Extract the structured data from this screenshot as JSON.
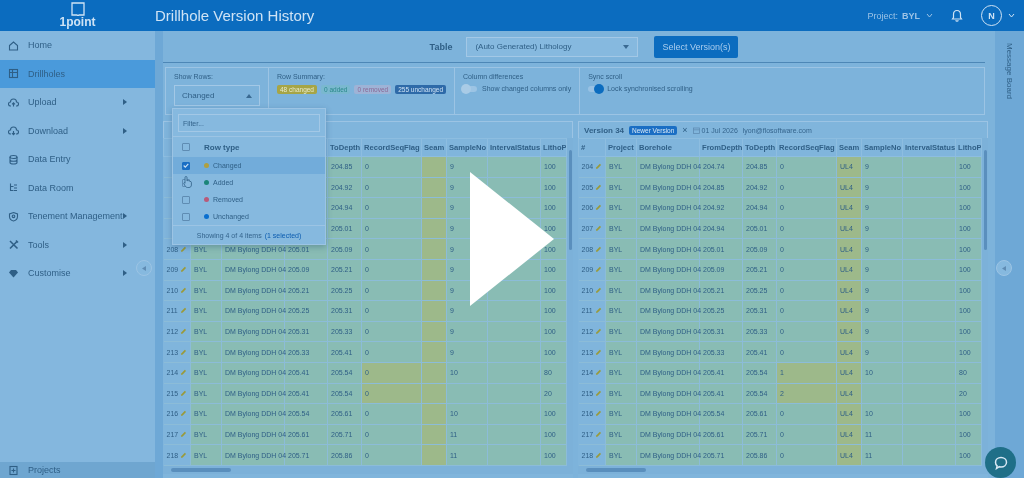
{
  "app": {
    "logo": "1point",
    "title": "Drillhole Version History",
    "project_label": "Project:",
    "project": "BYL",
    "avatar": "N"
  },
  "sidebar": {
    "items": [
      {
        "label": "Home",
        "selected": false,
        "submenu": false
      },
      {
        "label": "Drillholes",
        "selected": true,
        "submenu": false
      },
      {
        "label": "Upload",
        "selected": false,
        "submenu": true
      },
      {
        "label": "Download",
        "selected": false,
        "submenu": true
      },
      {
        "label": "Data Entry",
        "selected": false,
        "submenu": false
      },
      {
        "label": "Data Room",
        "selected": false,
        "submenu": false
      },
      {
        "label": "Tenement Management",
        "selected": false,
        "submenu": true
      },
      {
        "label": "Tools",
        "selected": false,
        "submenu": true
      },
      {
        "label": "Customise",
        "selected": false,
        "submenu": true
      }
    ],
    "footer": "Projects"
  },
  "toolbar": {
    "table_label": "Table",
    "table_value": "(Auto Generated) Lithology",
    "button": "Select Version(s)"
  },
  "filters": {
    "show_rows": {
      "label": "Show Rows:",
      "value": "Changed",
      "expanded": true
    },
    "row_summary": {
      "label": "Row Summary:",
      "badges": [
        {
          "text": "48 changed",
          "kind": "changed"
        },
        {
          "text": "0 added",
          "kind": "added"
        },
        {
          "text": "0 removed",
          "kind": "removed"
        },
        {
          "text": "255 unchanged",
          "kind": "unchanged"
        }
      ]
    },
    "column_differences": {
      "label": "Column differences",
      "toggle": "Show changed columns only",
      "on": false
    },
    "sync_scroll": {
      "label": "Sync scroll",
      "toggle": "Lock synchronised scrolling",
      "on": true
    }
  },
  "row_type_menu": {
    "placeholder": "Filter...",
    "header": "Row type",
    "header_checked": false,
    "items": [
      {
        "label": "Changed",
        "color": "#b0a040",
        "checked": true,
        "selected": true
      },
      {
        "label": "Added",
        "color": "#1b8579",
        "checked": false,
        "selected": false
      },
      {
        "label": "Removed",
        "color": "#b85a7a",
        "checked": false,
        "selected": false
      },
      {
        "label": "Unchanged",
        "color": "#0a6fcf",
        "checked": false,
        "selected": false
      }
    ],
    "footer": "Showing 4 of 4 items",
    "selection": "(1 selected)"
  },
  "left_table": {
    "columns": [
      null,
      null,
      null,
      null,
      {
        "label": "ToDepth"
      },
      {
        "label": "RecordSeqFlag"
      },
      {
        "label": "Seam",
        "highlight": true
      },
      {
        "label": "SampleNo"
      },
      {
        "label": "IntervalStatus"
      },
      {
        "label": "LithoP"
      }
    ],
    "rows": [
      {
        "changed": true,
        "cells": [
          null,
          null,
          null,
          null,
          "204.85",
          "0",
          null,
          "9",
          null,
          "100"
        ]
      },
      {
        "changed": true,
        "cells": [
          null,
          null,
          null,
          null,
          "204.92",
          "0",
          null,
          "9",
          null,
          "100"
        ]
      },
      {
        "changed": true,
        "cells": [
          null,
          null,
          null,
          null,
          "204.94",
          "0",
          null,
          "9",
          null,
          "100"
        ]
      },
      {
        "changed": true,
        "cells": [
          null,
          null,
          null,
          null,
          "205.01",
          "0",
          null,
          "9",
          null,
          "100"
        ]
      },
      {
        "changed": true,
        "cells": [
          "208",
          "BYL",
          "DM Bylong DDH 04",
          "205.01",
          "205.09",
          "0",
          null,
          "9",
          null,
          "100"
        ]
      },
      {
        "changed": true,
        "cells": [
          "209",
          "BYL",
          "DM Bylong DDH 04",
          "205.09",
          "205.21",
          "0",
          null,
          "9",
          null,
          "100"
        ]
      },
      {
        "changed": true,
        "cells": [
          "210",
          "BYL",
          "DM Bylong DDH 04",
          "205.21",
          "205.25",
          "0",
          null,
          "9",
          null,
          "100"
        ]
      },
      {
        "changed": true,
        "cells": [
          "211",
          "BYL",
          "DM Bylong DDH 04",
          "205.25",
          "205.31",
          "0",
          null,
          "9",
          null,
          "100"
        ]
      },
      {
        "changed": true,
        "cells": [
          "212",
          "BYL",
          "DM Bylong DDH 04",
          "205.31",
          "205.33",
          "0",
          null,
          "9",
          null,
          "100"
        ]
      },
      {
        "changed": true,
        "cells": [
          "213",
          "BYL",
          "DM Bylong DDH 04",
          "205.33",
          "205.41",
          "0",
          null,
          "9",
          null,
          "100"
        ]
      },
      {
        "changed": true,
        "cells": [
          "214",
          "BYL",
          "DM Bylong DDH 04",
          "205.41",
          "205.54",
          {
            "value": "0",
            "highlight": true
          },
          null,
          "10",
          null,
          "80"
        ]
      },
      {
        "changed": true,
        "cells": [
          "215",
          "BYL",
          "DM Bylong DDH 04",
          "205.41",
          "205.54",
          {
            "value": "0",
            "highlight": true
          },
          null,
          null,
          null,
          "20"
        ]
      },
      {
        "changed": true,
        "cells": [
          "216",
          "BYL",
          "DM Bylong DDH 04",
          "205.54",
          "205.61",
          "0",
          null,
          "10",
          null,
          "100"
        ]
      },
      {
        "changed": true,
        "cells": [
          "217",
          "BYL",
          "DM Bylong DDH 04",
          "205.61",
          "205.71",
          "0",
          null,
          "11",
          null,
          "100"
        ]
      },
      {
        "changed": true,
        "cells": [
          "218",
          "BYL",
          "DM Bylong DDH 04",
          "205.71",
          "205.86",
          "0",
          null,
          "11",
          null,
          "100"
        ]
      }
    ]
  },
  "right_table": {
    "version": "Version 34",
    "badge": "Newer Version",
    "close": "×",
    "date": "01 Jul 2026",
    "user": "lyon@flosoftware.com",
    "columns": [
      {
        "label": "#"
      },
      {
        "label": "Project"
      },
      {
        "label": "Borehole"
      },
      {
        "label": "FromDepth"
      },
      {
        "label": "ToDepth"
      },
      {
        "label": "RecordSeqFlag"
      },
      {
        "label": "Seam",
        "highlight": true
      },
      {
        "label": "SampleNo"
      },
      {
        "label": "IntervalStatus"
      },
      {
        "label": "LithoP"
      }
    ],
    "rows": [
      {
        "changed": true,
        "cells": [
          "204",
          "BYL",
          "DM Bylong DDH 04",
          "204.74",
          "204.85",
          "0",
          "UL4",
          "9",
          null,
          "100"
        ]
      },
      {
        "changed": true,
        "cells": [
          "205",
          "BYL",
          "DM Bylong DDH 04",
          "204.85",
          "204.92",
          "0",
          "UL4",
          "9",
          null,
          "100"
        ]
      },
      {
        "changed": true,
        "cells": [
          "206",
          "BYL",
          "DM Bylong DDH 04",
          "204.92",
          "204.94",
          "0",
          "UL4",
          "9",
          null,
          "100"
        ]
      },
      {
        "changed": true,
        "cells": [
          "207",
          "BYL",
          "DM Bylong DDH 04",
          "204.94",
          "205.01",
          "0",
          "UL4",
          "9",
          null,
          "100"
        ]
      },
      {
        "changed": true,
        "cells": [
          "208",
          "BYL",
          "DM Bylong DDH 04",
          "205.01",
          "205.09",
          "0",
          "UL4",
          "9",
          null,
          "100"
        ]
      },
      {
        "changed": true,
        "cells": [
          "209",
          "BYL",
          "DM Bylong DDH 04",
          "205.09",
          "205.21",
          "0",
          "UL4",
          "9",
          null,
          "100"
        ]
      },
      {
        "changed": true,
        "cells": [
          "210",
          "BYL",
          "DM Bylong DDH 04",
          "205.21",
          "205.25",
          "0",
          "UL4",
          "9",
          null,
          "100"
        ]
      },
      {
        "changed": true,
        "cells": [
          "211",
          "BYL",
          "DM Bylong DDH 04",
          "205.25",
          "205.31",
          "0",
          "UL4",
          "9",
          null,
          "100"
        ]
      },
      {
        "changed": true,
        "cells": [
          "212",
          "BYL",
          "DM Bylong DDH 04",
          "205.31",
          "205.33",
          "0",
          "UL4",
          "9",
          null,
          "100"
        ]
      },
      {
        "changed": true,
        "cells": [
          "213",
          "BYL",
          "DM Bylong DDH 04",
          "205.33",
          "205.41",
          "0",
          "UL4",
          "9",
          null,
          "100"
        ]
      },
      {
        "changed": true,
        "cells": [
          "214",
          "BYL",
          "DM Bylong DDH 04",
          "205.41",
          "205.54",
          {
            "value": "1",
            "highlight": true
          },
          "UL4",
          "10",
          null,
          "80"
        ]
      },
      {
        "changed": true,
        "cells": [
          "215",
          "BYL",
          "DM Bylong DDH 04",
          "205.41",
          "205.54",
          {
            "value": "2",
            "highlight": true
          },
          "UL4",
          null,
          null,
          "20"
        ]
      },
      {
        "changed": true,
        "cells": [
          "216",
          "BYL",
          "DM Bylong DDH 04",
          "205.54",
          "205.61",
          "0",
          "UL4",
          "10",
          null,
          "100"
        ]
      },
      {
        "changed": true,
        "cells": [
          "217",
          "BYL",
          "DM Bylong DDH 04",
          "205.61",
          "205.71",
          "0",
          "UL4",
          "11",
          null,
          "100"
        ]
      },
      {
        "changed": true,
        "cells": [
          "218",
          "BYL",
          "DM Bylong DDH 04",
          "205.71",
          "205.86",
          "0",
          "UL4",
          "11",
          null,
          "100"
        ]
      }
    ]
  },
  "message_board": "Message Board"
}
